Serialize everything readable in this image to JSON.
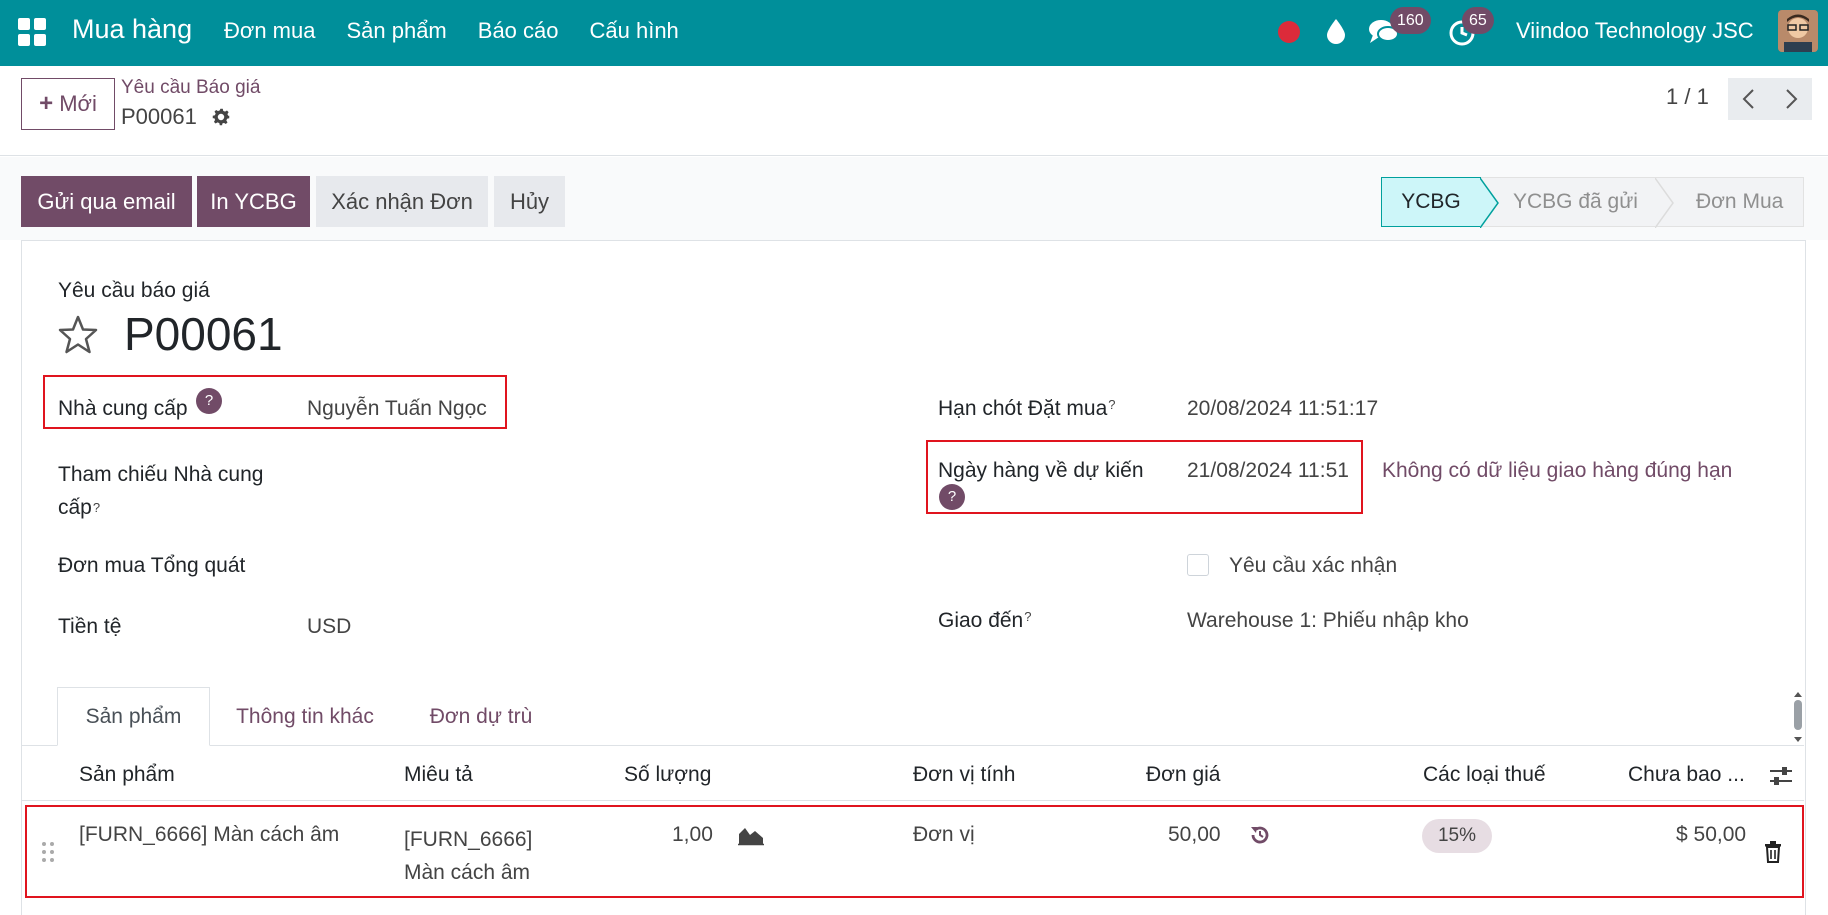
{
  "navbar": {
    "brand": "Mua hàng",
    "menu": [
      "Đơn mua",
      "Sản phẩm",
      "Báo cáo",
      "Cấu hình"
    ],
    "chat_count": "160",
    "activity_count": "65",
    "company": "Viindoo Technology JSC",
    "icons": [
      "apps-icon",
      "record-icon",
      "drop-icon",
      "chat-icon",
      "activity-clock-icon",
      "avatar"
    ]
  },
  "control": {
    "new_label": "Mới",
    "breadcrumb": "Yêu cầu Báo giá",
    "record": "P00061",
    "pager": "1 / 1"
  },
  "status": {
    "buttons": {
      "email": "Gửi qua email",
      "print": "In YCBG",
      "confirm": "Xác nhận Đơn",
      "cancel": "Hủy"
    },
    "stages": [
      "YCBG",
      "YCBG đã gửi",
      "Đơn Mua"
    ],
    "active_stage": "YCBG"
  },
  "form": {
    "doc_label": "Yêu cầu báo giá",
    "doc_title": "P00061",
    "vendor_label": "Nhà cung cấp",
    "vendor_value": "Nguyễn Tuấn Ngọc",
    "vendor_ref_label_1": "Tham chiếu Nhà cung",
    "vendor_ref_label_2": "cấp",
    "blanket_label": "Đơn mua Tổng quát",
    "currency_label": "Tiền tệ",
    "currency_value": "USD",
    "deadline_label": "Hạn chót Đặt mua",
    "deadline_value": "20/08/2024 11:51:17",
    "expected_label": "Ngày hàng về dự kiến",
    "expected_value": "21/08/2024 11:51",
    "on_time_warning": "Không có dữ liệu giao hàng đúng hạn",
    "ask_confirm_label": "Yêu cầu xác nhận",
    "ask_confirm_checked": false,
    "deliver_to_label": "Giao đến",
    "deliver_to_value": "Warehouse 1: Phiếu nhập kho",
    "help_mark": "?"
  },
  "tabs": [
    "Sản phẩm",
    "Thông tin khác",
    "Đơn dự trù"
  ],
  "lines": {
    "headers": [
      "Sản phẩm",
      "Miêu tả",
      "Số lượng",
      "Đơn vị tính",
      "Đơn giá",
      "Các loại thuế",
      "Chưa bao ..."
    ],
    "rows": [
      {
        "product": "[FURN_6666] Màn cách âm",
        "description_1": "[FURN_6666]",
        "description_2": "Màn cách âm",
        "quantity": "1,00",
        "uom": "Đơn vị",
        "price": "50,00",
        "tax": "15%",
        "subtotal": "$ 50,00"
      }
    ]
  },
  "colors": {
    "navbar": "#008f9a",
    "primary": "#714b67",
    "highlight": "#e0141e",
    "active_stage": "#cdf6f9"
  }
}
